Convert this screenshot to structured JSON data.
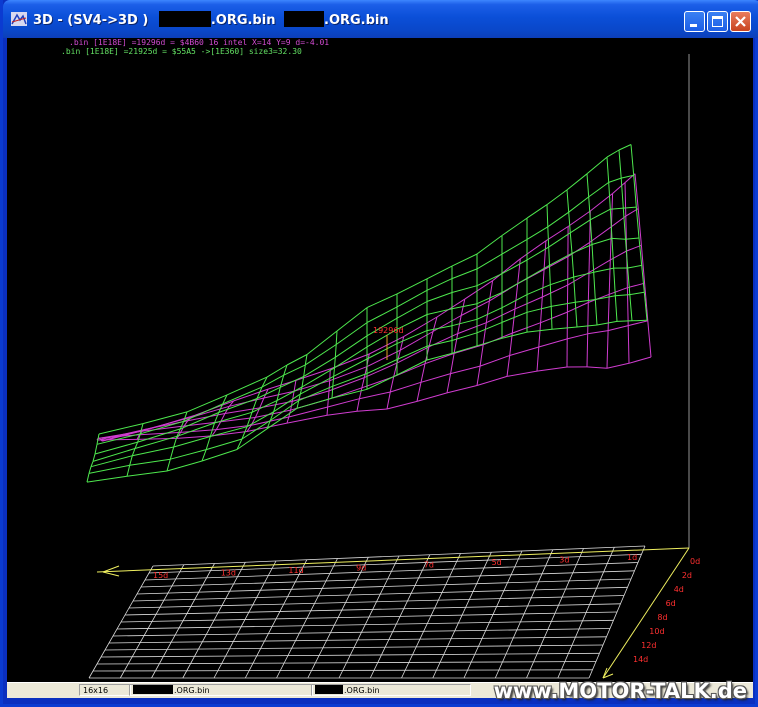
{
  "window": {
    "title_prefix": "3D -   (SV4->3D )",
    "title_file1": ".ORG.bin",
    "title_file2": ".ORG.bin",
    "icon": "app-3d-icon",
    "controls": [
      "minimize-icon",
      "maximize-icon",
      "close-icon"
    ]
  },
  "info": {
    "line1": ".bin [1E18E] =19296d = $4B60  16 intel   X=14  Y=9  d=-4.01",
    "line2": ".bin [1E18E] =21925d = $55A5 ->[1E360] size3=32.30"
  },
  "plot": {
    "point_label": "19296d",
    "x_ticks": [
      "15d",
      "13d",
      "11d",
      "9d",
      "7d",
      "5d",
      "3d",
      "1d"
    ],
    "y_ticks": [
      "0d",
      "2d",
      "4d",
      "6d",
      "8d",
      "10d",
      "12d",
      "14d"
    ],
    "colors": {
      "map1": "#4ee84e",
      "map2": "#d03cd0",
      "grid": "#dcdcdc",
      "axis": "#f0f060",
      "labels": "#ff3030"
    }
  },
  "status": {
    "field1": "16x16",
    "field2": ".ORG.bin",
    "field3": ".ORG.bin"
  },
  "watermark": "www.MOTOR-TALK.de"
}
